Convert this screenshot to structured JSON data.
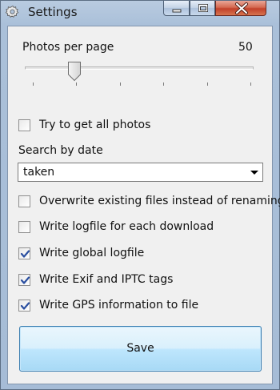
{
  "window": {
    "title": "Settings",
    "icon": "gear-icon"
  },
  "photos_per_page": {
    "label": "Photos per page",
    "value": "50",
    "slider_fraction": 0.2
  },
  "options": {
    "try_all_photos": {
      "label": "Try to get all photos",
      "checked": false
    },
    "search_by_date_label": "Search by date",
    "search_by_date_value": "taken",
    "overwrite": {
      "label": "Overwrite existing files instead of renaming",
      "checked": false
    },
    "logfile_each": {
      "label": "Write logfile for each download",
      "checked": false
    },
    "global_logfile": {
      "label": "Write global logfile",
      "checked": true
    },
    "exif_iptc": {
      "label": "Write Exif and IPTC tags",
      "checked": true
    },
    "gps": {
      "label": "Write GPS information to file",
      "checked": true
    }
  },
  "save_label": "Save"
}
